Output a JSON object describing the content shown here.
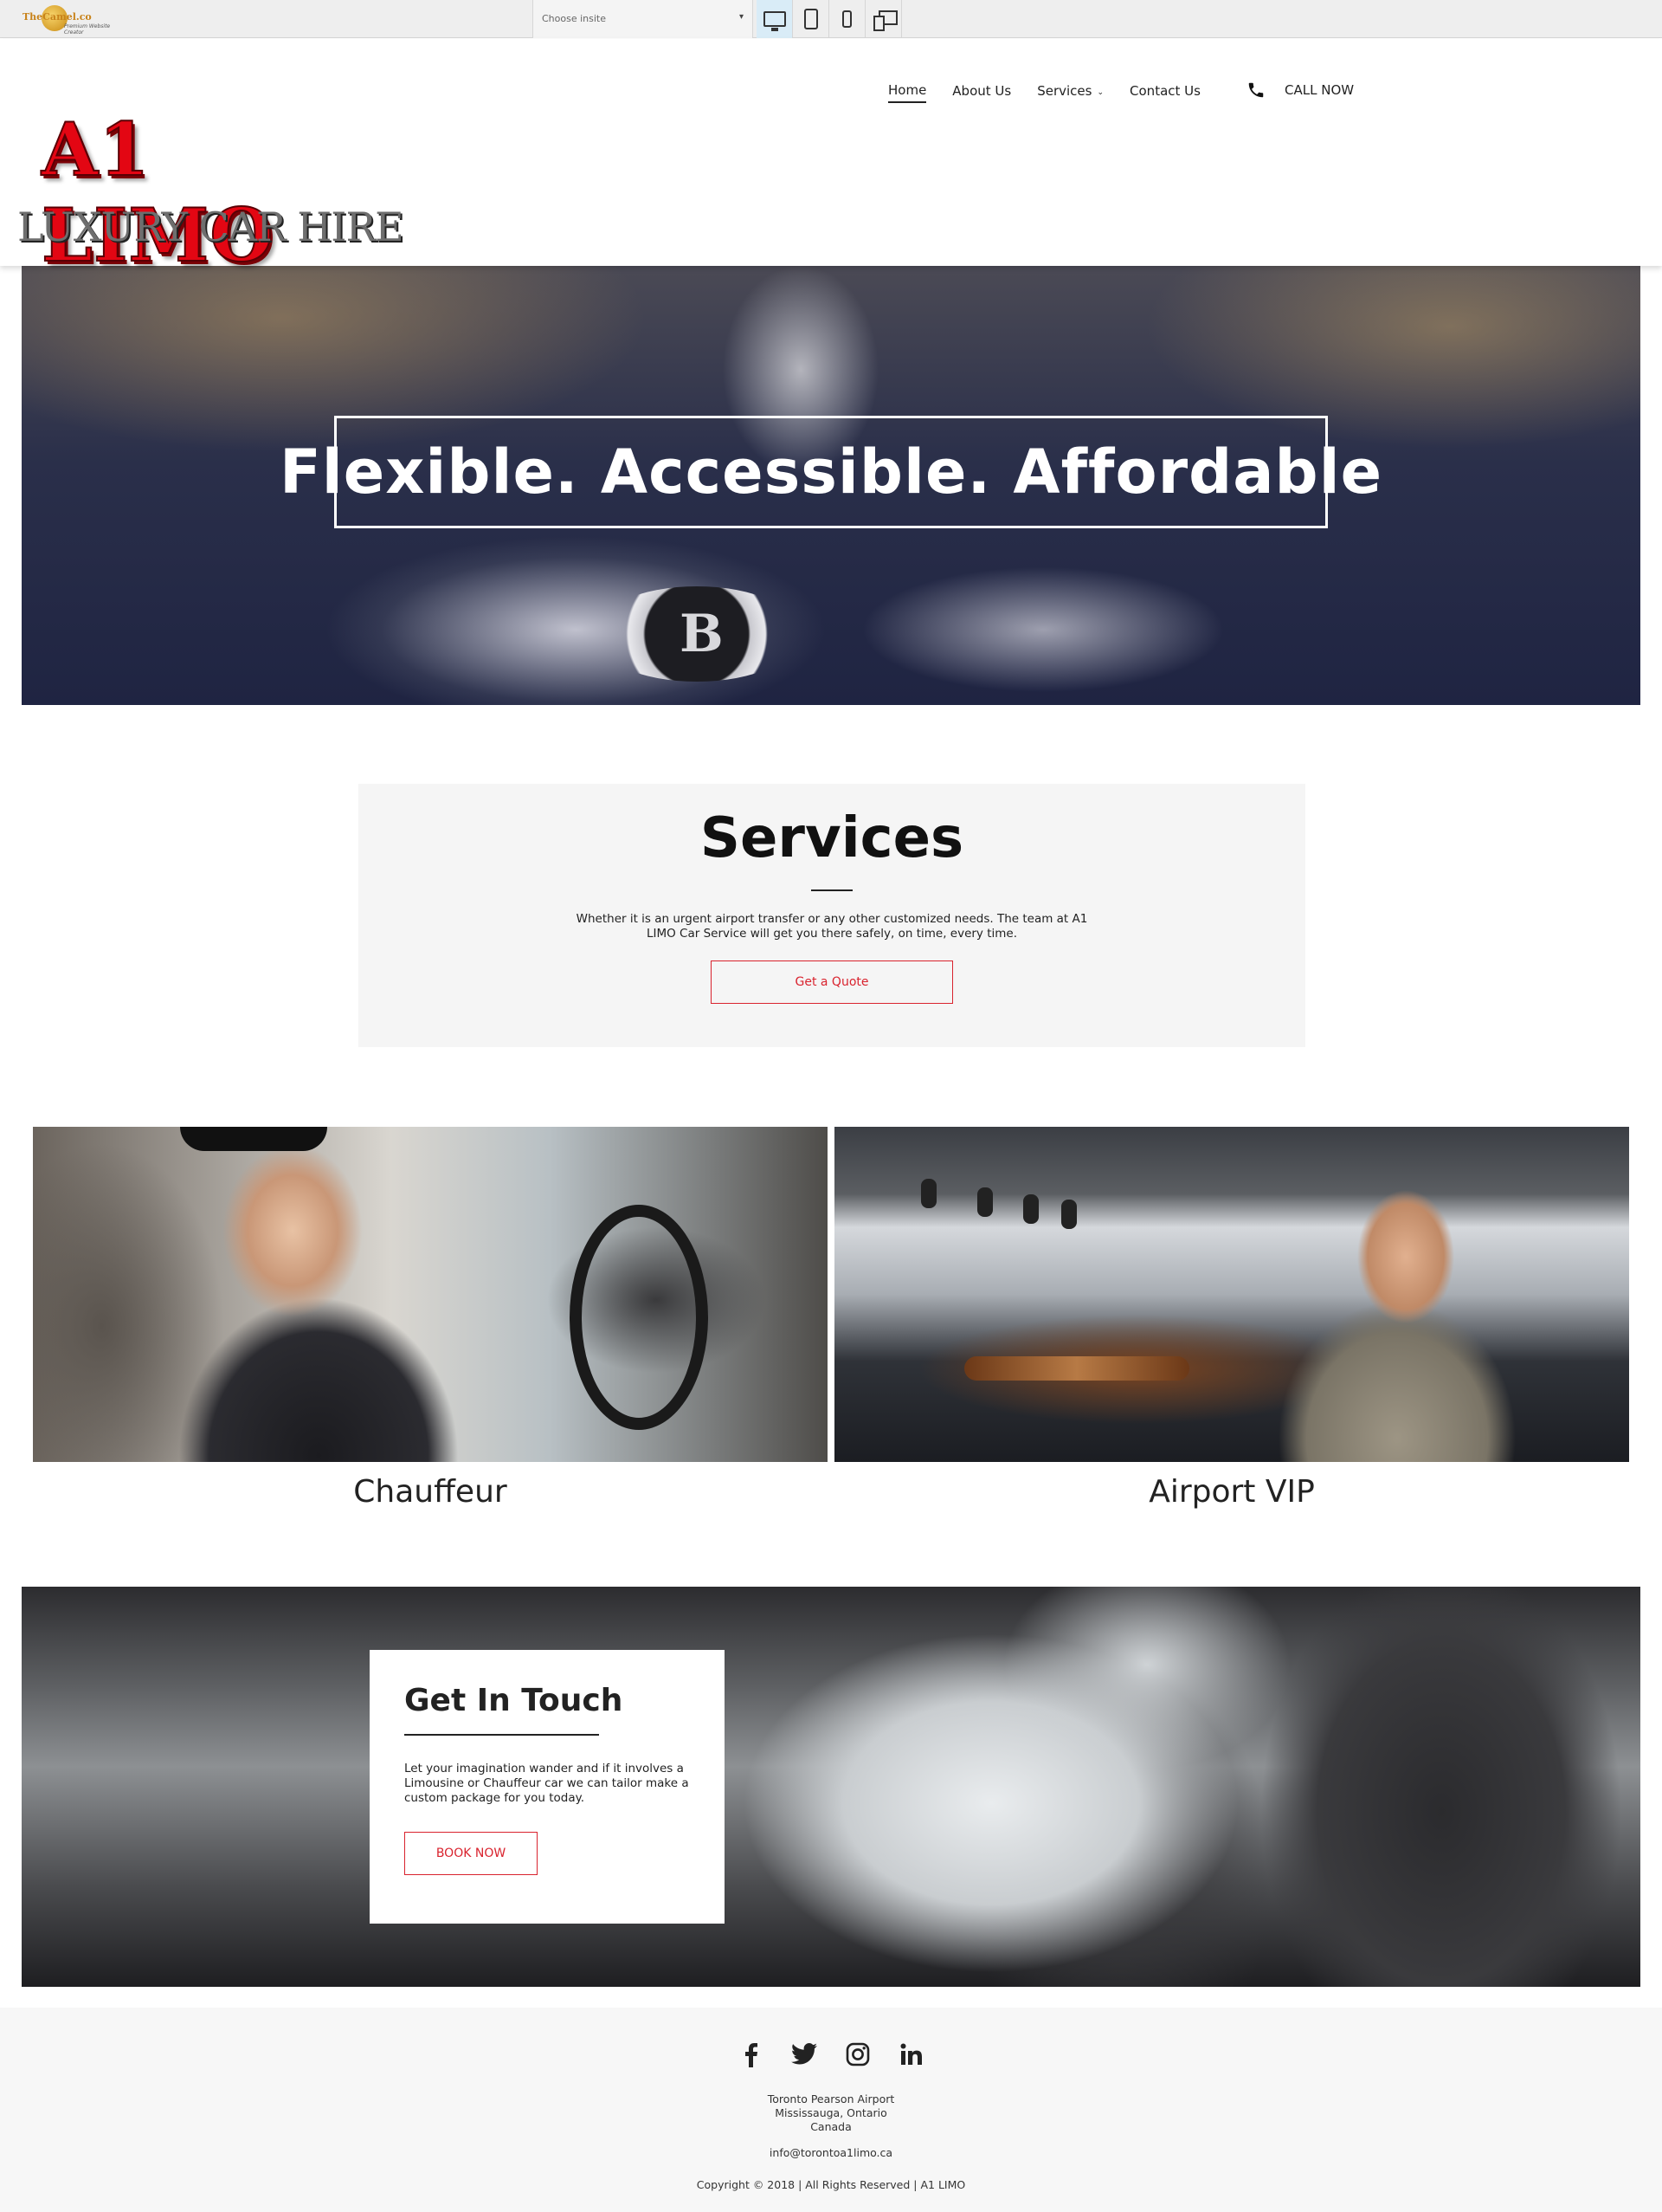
{
  "toolbar": {
    "logo_text": "TheCamel.co",
    "logo_tagline": "Premium Website Creator",
    "site_select_placeholder": "Choose insite",
    "devices": [
      "desktop-icon",
      "tablet-icon",
      "phone-icon",
      "multi-device-icon"
    ],
    "active_device": "desktop"
  },
  "header": {
    "logo_title": "A1 LIMO",
    "logo_subtitle": "LUXURY CAR HIRE",
    "nav": [
      {
        "label": "Home",
        "active": true
      },
      {
        "label": "About Us"
      },
      {
        "label": "Services",
        "has_dropdown": true
      },
      {
        "label": "Contact Us"
      }
    ],
    "call_label": "CALL NOW"
  },
  "hero": {
    "title": "Flexible. Accessible. Affordable"
  },
  "services": {
    "title": "Services",
    "text": "Whether it is an urgent airport transfer or any other customized needs. The team at A1 LIMO Car Service will get you there safely, on time, every time.",
    "button_label": "Get a Quote",
    "cards": [
      {
        "caption": "Chauffeur"
      },
      {
        "caption": "Airport VIP"
      }
    ]
  },
  "touch": {
    "title": "Get In Touch",
    "text": "Let your imagination wander and if it involves a Limousine or Chauffeur car we can tailor make a custom package for you today.",
    "button_label": "BOOK NOW"
  },
  "footer": {
    "social": [
      "facebook-icon",
      "twitter-icon",
      "instagram-icon",
      "linkedin-icon"
    ],
    "address_line1": "Toronto Pearson Airport",
    "address_line2": "Mississauga, Ontario",
    "address_line3": "Canada",
    "email": "info@torontoa1limo.ca",
    "copyright": "Copyright © 2018 | All Rights Reserved | A1 LIMO"
  },
  "colors": {
    "accent_red": "#d9232e",
    "logo_red": "#e30613",
    "toolbar_bg": "#eeeeee",
    "panel_bg": "#f5f5f5"
  }
}
